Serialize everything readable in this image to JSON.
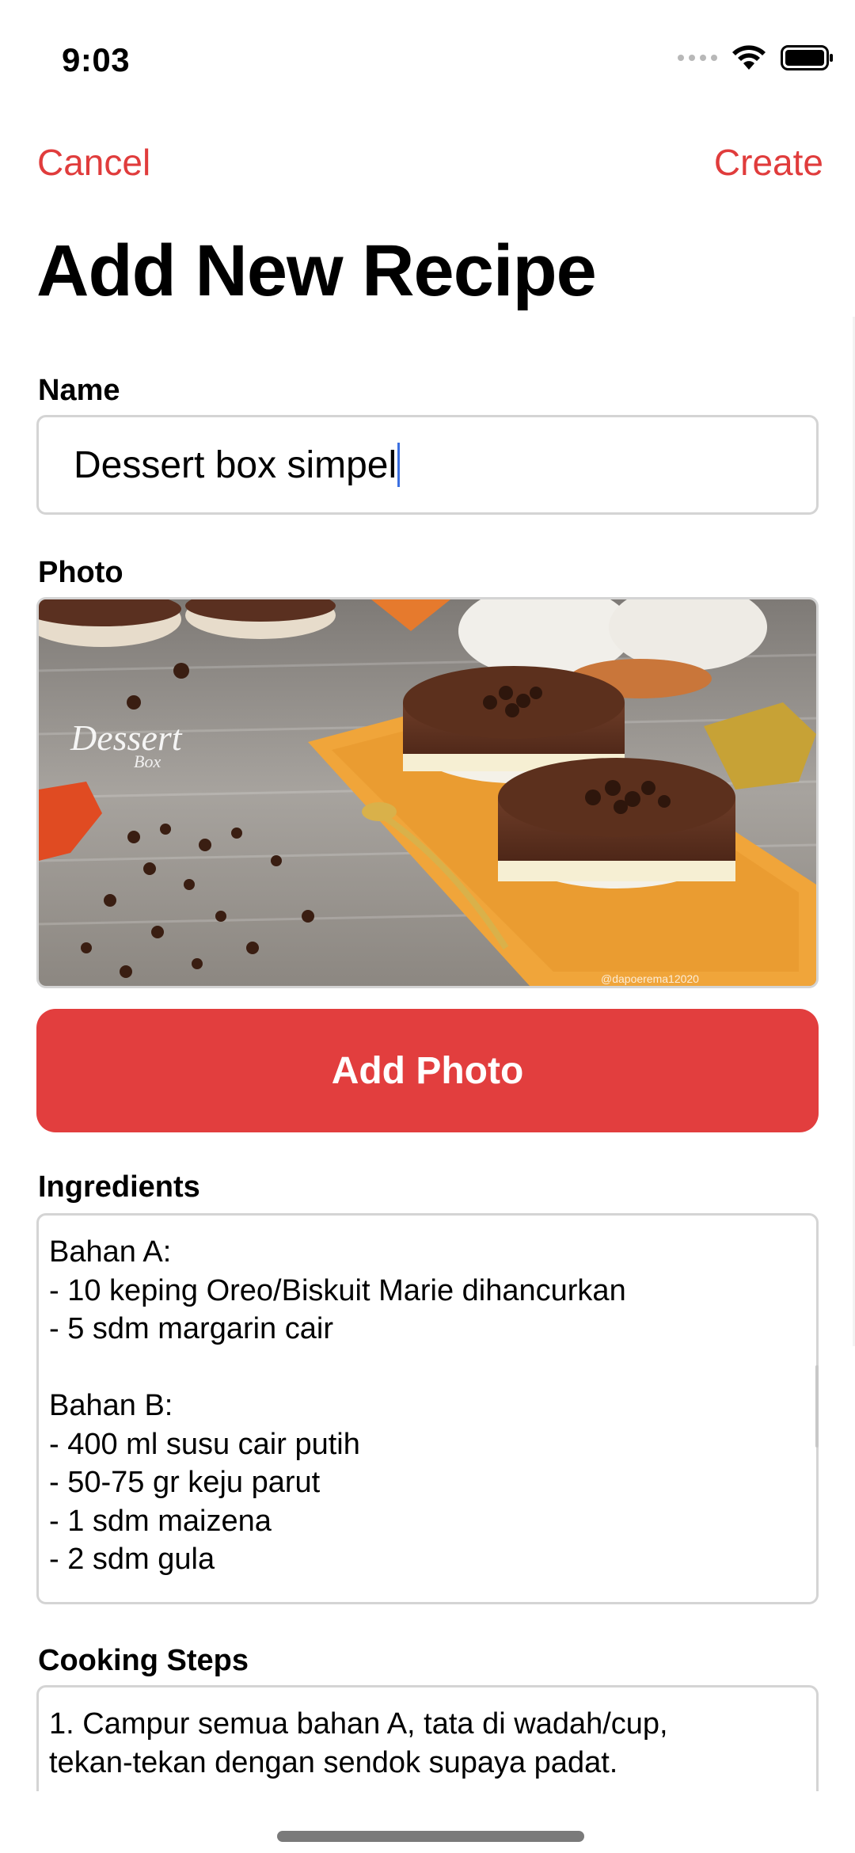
{
  "status_bar": {
    "time": "9:03"
  },
  "nav": {
    "cancel_label": "Cancel",
    "create_label": "Create"
  },
  "page": {
    "title": "Add New Recipe"
  },
  "name_section": {
    "label": "Name",
    "value": "Dessert box simpel"
  },
  "photo_section": {
    "label": "Photo",
    "image_caption": "Dessert",
    "image_caption_sub": "Box",
    "watermark": "@dapoerema12020",
    "add_button_label": "Add Photo"
  },
  "ingredients_section": {
    "label": "Ingredients",
    "text": "Bahan A:\n- 10 keping Oreo/Biskuit Marie dihancurkan\n- 5 sdm margarin cair\n\nBahan B:\n- 400 ml susu cair putih\n- 50-75 gr keju parut\n- 1 sdm maizena\n- 2 sdm gula"
  },
  "steps_section": {
    "label": "Cooking Steps",
    "text": "1. Campur semua bahan A, tata di wadah/cup,\ntekan-tekan dengan sendok supaya padat."
  },
  "colors": {
    "accent": "#e23e3e",
    "field_border": "#d4d4d4"
  },
  "icons": [
    "cellular-signal-icon",
    "wifi-icon",
    "battery-icon"
  ]
}
